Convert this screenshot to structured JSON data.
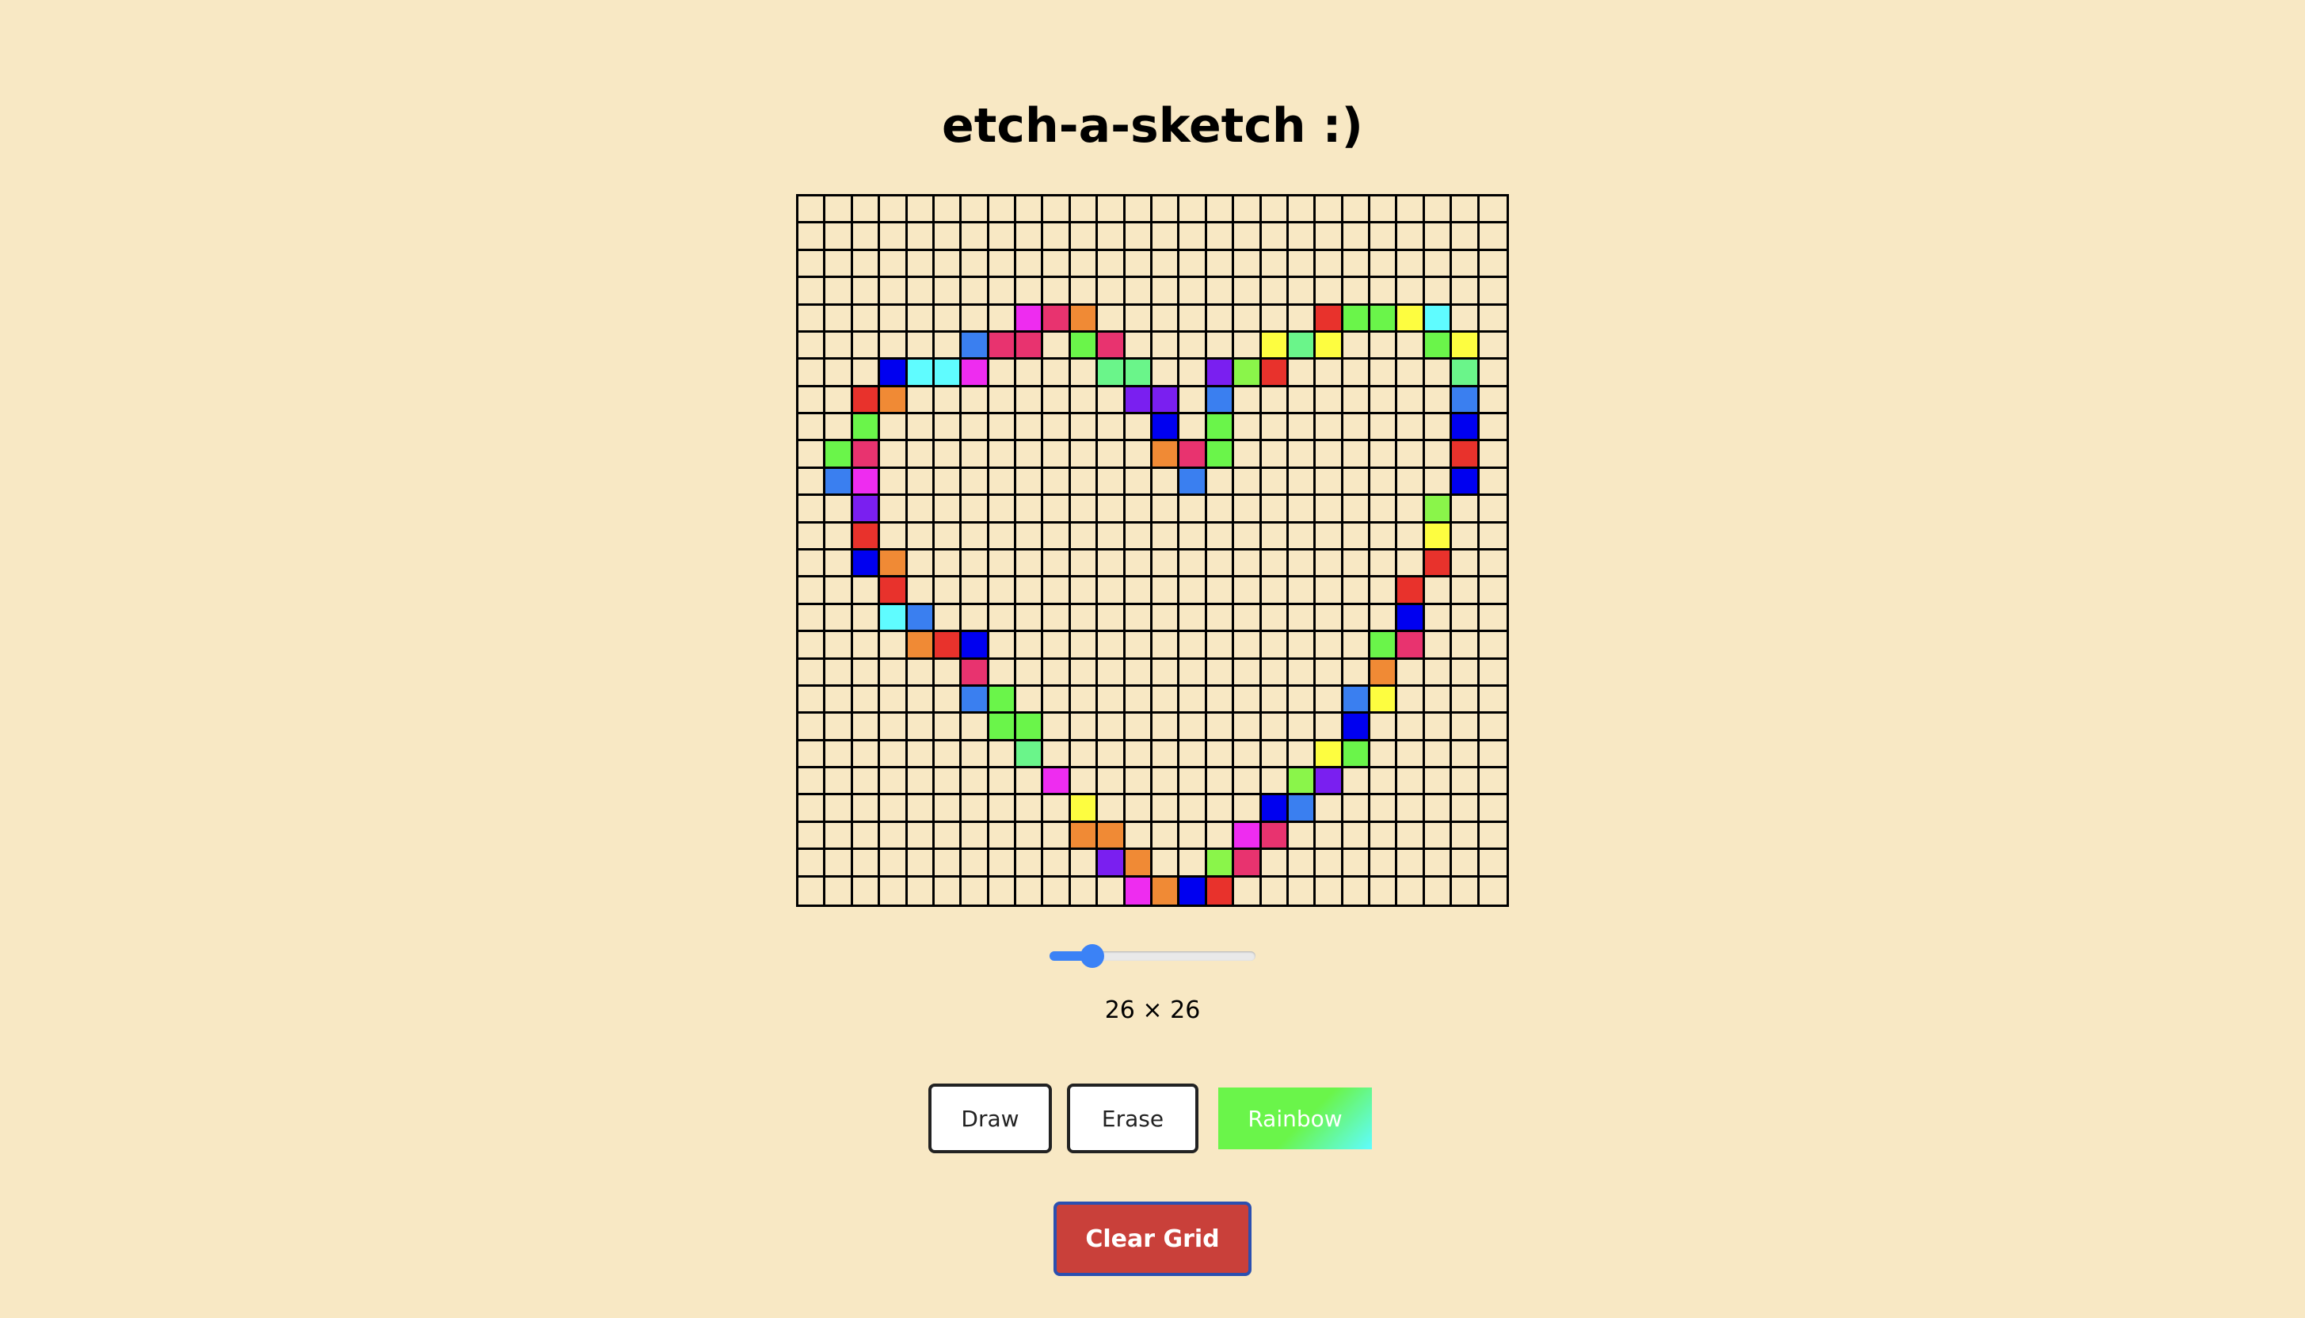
{
  "title": "etch-a-sketch :)",
  "grid": {
    "size": 26,
    "cells": [
      {
        "r": 4,
        "c": 8,
        "color": "#ee2cf0"
      },
      {
        "r": 4,
        "c": 9,
        "color": "#e8336f"
      },
      {
        "r": 4,
        "c": 10,
        "color": "#f08a35"
      },
      {
        "r": 4,
        "c": 19,
        "color": "#e8322c"
      },
      {
        "r": 4,
        "c": 20,
        "color": "#6af54a"
      },
      {
        "r": 4,
        "c": 21,
        "color": "#6af54a"
      },
      {
        "r": 4,
        "c": 22,
        "color": "#fdfd40"
      },
      {
        "r": 4,
        "c": 23,
        "color": "#5ffcff"
      },
      {
        "r": 5,
        "c": 6,
        "color": "#3a7ff0"
      },
      {
        "r": 5,
        "c": 7,
        "color": "#e8336f"
      },
      {
        "r": 5,
        "c": 8,
        "color": "#e8336f"
      },
      {
        "r": 5,
        "c": 10,
        "color": "#6af54a"
      },
      {
        "r": 5,
        "c": 11,
        "color": "#e8336f"
      },
      {
        "r": 5,
        "c": 17,
        "color": "#fdfd40"
      },
      {
        "r": 5,
        "c": 18,
        "color": "#6af58a"
      },
      {
        "r": 5,
        "c": 19,
        "color": "#fdfd40"
      },
      {
        "r": 5,
        "c": 23,
        "color": "#6af54a"
      },
      {
        "r": 5,
        "c": 24,
        "color": "#fdfd40"
      },
      {
        "r": 6,
        "c": 3,
        "color": "#0000f0"
      },
      {
        "r": 6,
        "c": 4,
        "color": "#5ffcff"
      },
      {
        "r": 6,
        "c": 5,
        "color": "#5ffcff"
      },
      {
        "r": 6,
        "c": 6,
        "color": "#ee2cf0"
      },
      {
        "r": 6,
        "c": 11,
        "color": "#6af58a"
      },
      {
        "r": 6,
        "c": 12,
        "color": "#6af58a"
      },
      {
        "r": 6,
        "c": 15,
        "color": "#7a1ff0"
      },
      {
        "r": 6,
        "c": 16,
        "color": "#8af54a"
      },
      {
        "r": 6,
        "c": 17,
        "color": "#e8322c"
      },
      {
        "r": 6,
        "c": 24,
        "color": "#6af58a"
      },
      {
        "r": 7,
        "c": 2,
        "color": "#e8322c"
      },
      {
        "r": 7,
        "c": 3,
        "color": "#f08a35"
      },
      {
        "r": 7,
        "c": 12,
        "color": "#7a1ff0"
      },
      {
        "r": 7,
        "c": 13,
        "color": "#7a1ff0"
      },
      {
        "r": 7,
        "c": 15,
        "color": "#3a7ff0"
      },
      {
        "r": 7,
        "c": 24,
        "color": "#3a7ff0"
      },
      {
        "r": 8,
        "c": 2,
        "color": "#6af54a"
      },
      {
        "r": 8,
        "c": 13,
        "color": "#0000f0"
      },
      {
        "r": 8,
        "c": 15,
        "color": "#6af54a"
      },
      {
        "r": 8,
        "c": 24,
        "color": "#0000f0"
      },
      {
        "r": 9,
        "c": 1,
        "color": "#6af54a"
      },
      {
        "r": 9,
        "c": 2,
        "color": "#e8336f"
      },
      {
        "r": 9,
        "c": 13,
        "color": "#f08a35"
      },
      {
        "r": 9,
        "c": 14,
        "color": "#e8336f"
      },
      {
        "r": 9,
        "c": 15,
        "color": "#6af54a"
      },
      {
        "r": 9,
        "c": 24,
        "color": "#e8322c"
      },
      {
        "r": 10,
        "c": 1,
        "color": "#3a7ff0"
      },
      {
        "r": 10,
        "c": 2,
        "color": "#ee2cf0"
      },
      {
        "r": 10,
        "c": 14,
        "color": "#3a7ff0"
      },
      {
        "r": 10,
        "c": 24,
        "color": "#0000f0"
      },
      {
        "r": 11,
        "c": 2,
        "color": "#7a1ff0"
      },
      {
        "r": 11,
        "c": 23,
        "color": "#8af54a"
      },
      {
        "r": 12,
        "c": 2,
        "color": "#e8322c"
      },
      {
        "r": 12,
        "c": 23,
        "color": "#fdfd40"
      },
      {
        "r": 13,
        "c": 2,
        "color": "#0000f0"
      },
      {
        "r": 13,
        "c": 3,
        "color": "#f08a35"
      },
      {
        "r": 13,
        "c": 23,
        "color": "#e8322c"
      },
      {
        "r": 14,
        "c": 3,
        "color": "#e8322c"
      },
      {
        "r": 14,
        "c": 22,
        "color": "#e8322c"
      },
      {
        "r": 15,
        "c": 3,
        "color": "#5ffcff"
      },
      {
        "r": 15,
        "c": 4,
        "color": "#3a7ff0"
      },
      {
        "r": 15,
        "c": 22,
        "color": "#0000f0"
      },
      {
        "r": 16,
        "c": 4,
        "color": "#f08a35"
      },
      {
        "r": 16,
        "c": 5,
        "color": "#e8322c"
      },
      {
        "r": 16,
        "c": 6,
        "color": "#0000f0"
      },
      {
        "r": 16,
        "c": 21,
        "color": "#6af54a"
      },
      {
        "r": 16,
        "c": 22,
        "color": "#e8336f"
      },
      {
        "r": 17,
        "c": 6,
        "color": "#e8336f"
      },
      {
        "r": 17,
        "c": 21,
        "color": "#f08a35"
      },
      {
        "r": 18,
        "c": 6,
        "color": "#3a7ff0"
      },
      {
        "r": 18,
        "c": 7,
        "color": "#6af54a"
      },
      {
        "r": 18,
        "c": 20,
        "color": "#3a7ff0"
      },
      {
        "r": 18,
        "c": 21,
        "color": "#fdfd40"
      },
      {
        "r": 19,
        "c": 7,
        "color": "#6af54a"
      },
      {
        "r": 19,
        "c": 8,
        "color": "#6af54a"
      },
      {
        "r": 19,
        "c": 20,
        "color": "#0000f0"
      },
      {
        "r": 20,
        "c": 8,
        "color": "#6af58a"
      },
      {
        "r": 20,
        "c": 19,
        "color": "#fdfd40"
      },
      {
        "r": 20,
        "c": 20,
        "color": "#6af54a"
      },
      {
        "r": 21,
        "c": 9,
        "color": "#ee2cf0"
      },
      {
        "r": 21,
        "c": 18,
        "color": "#8af54a"
      },
      {
        "r": 21,
        "c": 19,
        "color": "#7a1ff0"
      },
      {
        "r": 22,
        "c": 10,
        "color": "#fdfd40"
      },
      {
        "r": 22,
        "c": 17,
        "color": "#0000f0"
      },
      {
        "r": 22,
        "c": 18,
        "color": "#3a7ff0"
      },
      {
        "r": 23,
        "c": 10,
        "color": "#f08a35"
      },
      {
        "r": 23,
        "c": 11,
        "color": "#f08a35"
      },
      {
        "r": 23,
        "c": 16,
        "color": "#ee2cf0"
      },
      {
        "r": 23,
        "c": 17,
        "color": "#e8336f"
      },
      {
        "r": 24,
        "c": 11,
        "color": "#7a1ff0"
      },
      {
        "r": 24,
        "c": 12,
        "color": "#f08a35"
      },
      {
        "r": 24,
        "c": 15,
        "color": "#8af54a"
      },
      {
        "r": 24,
        "c": 16,
        "color": "#e8336f"
      },
      {
        "r": 25,
        "c": 12,
        "color": "#ee2cf0"
      },
      {
        "r": 25,
        "c": 13,
        "color": "#f08a35"
      },
      {
        "r": 25,
        "c": 14,
        "color": "#0000f0"
      },
      {
        "r": 25,
        "c": 15,
        "color": "#e8322c"
      }
    ]
  },
  "slider": {
    "value": 26,
    "min": 16,
    "max": 100
  },
  "size_label": "26 × 26",
  "buttons": {
    "draw": "Draw",
    "erase": "Erase",
    "rainbow": "Rainbow",
    "clear": "Clear Grid"
  },
  "colors": {
    "background": "#f8e8c4",
    "grid_line": "#000000",
    "slider_accent": "#3b82f6",
    "clear_button": "#c9403a"
  }
}
